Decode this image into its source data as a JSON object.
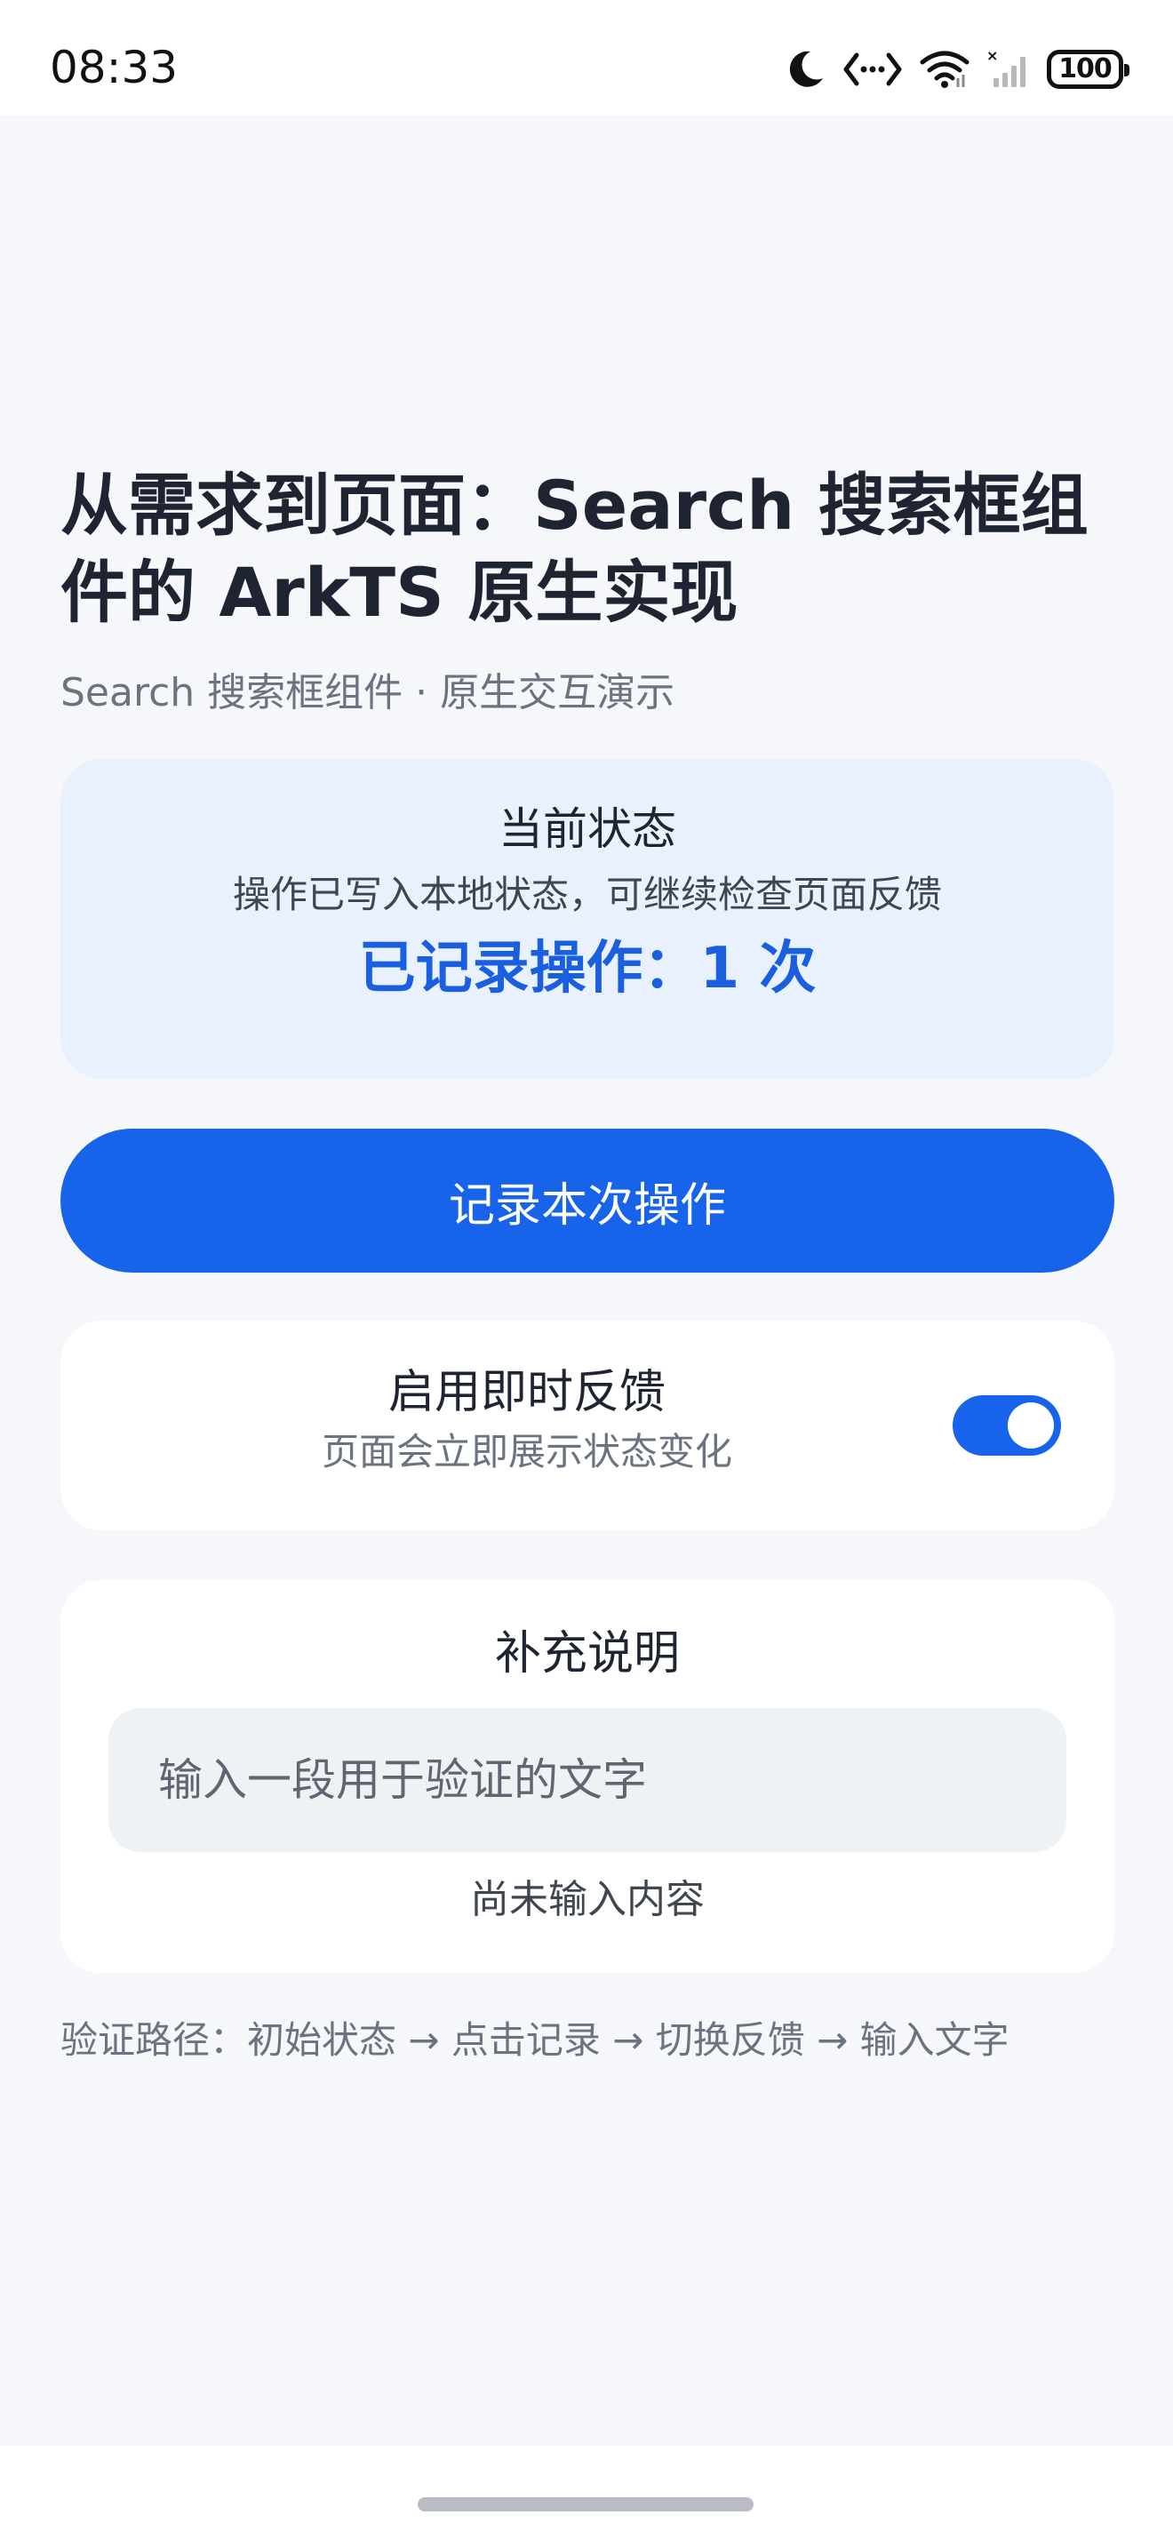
{
  "status_bar": {
    "time": "08:33",
    "icons": [
      "moon-icon",
      "code-arrows-icon",
      "wifi-icon",
      "cellular-signal-icon",
      "battery-icon"
    ],
    "battery_level": "100"
  },
  "page": {
    "title": "从需求到页面：Search 搜索框组件的 ArkTS 原生实现",
    "subtitle": "Search 搜索框组件 · 原生交互演示"
  },
  "status_card": {
    "title": "当前状态",
    "description": "操作已写入本地状态，可继续检查页面反馈",
    "count_text": "已记录操作：1 次"
  },
  "record_button": {
    "label": "记录本次操作"
  },
  "feedback_toggle": {
    "title": "启用即时反馈",
    "description": "页面会立即展示状态变化",
    "enabled": true
  },
  "note_card": {
    "title": "补充说明",
    "input_value": "",
    "input_placeholder": "输入一段用于验证的文字",
    "status": "尚未输入内容"
  },
  "verify_path": "验证路径：初始状态 → 点击记录 → 切换反馈 → 输入文字",
  "colors": {
    "accent": "#1764ea",
    "status_card_bg": "#e9f1fe",
    "page_bg": "#f5f7fa",
    "count_text": "#1a5fe0"
  }
}
